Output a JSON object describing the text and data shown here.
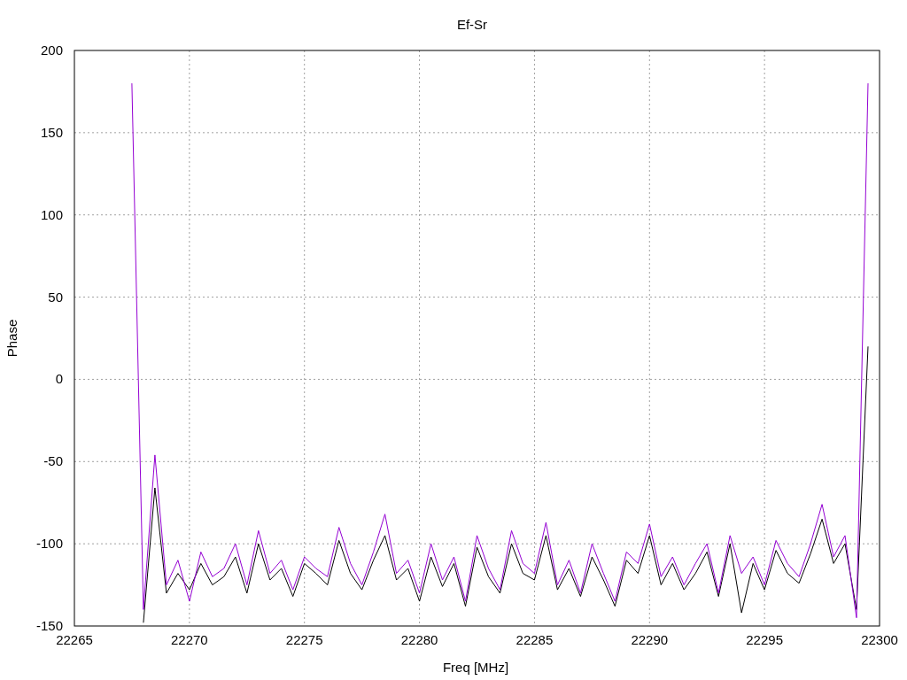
{
  "chart_data": {
    "type": "line",
    "grid": true,
    "title": "Ef-Sr",
    "xlabel": "Freq [MHz]",
    "ylabel": "Phase",
    "xlim": [
      22265,
      22300
    ],
    "ylim": [
      -150,
      200
    ],
    "xticks": [
      22265,
      22270,
      22275,
      22280,
      22285,
      22290,
      22295,
      22300
    ],
    "yticks": [
      -150,
      -100,
      -50,
      0,
      50,
      100,
      150,
      200
    ],
    "x": [
      22267.5,
      22268,
      22268.5,
      22269,
      22269.5,
      22270,
      22270.5,
      22271,
      22271.5,
      22272,
      22272.5,
      22273,
      22273.5,
      22274,
      22274.5,
      22275,
      22275.5,
      22276,
      22276.5,
      22277,
      22277.5,
      22278,
      22278.5,
      22279,
      22279.5,
      22280,
      22280.5,
      22281,
      22281.5,
      22282,
      22282.5,
      22283,
      22283.5,
      22284,
      22284.5,
      22285,
      22285.5,
      22286,
      22286.5,
      22287,
      22287.5,
      22288,
      22288.5,
      22289,
      22289.5,
      22290,
      22290.5,
      22291,
      22291.5,
      22292,
      22292.5,
      22293,
      22293.5,
      22294,
      22294.5,
      22295,
      22295.5,
      22296,
      22296.5,
      22297,
      22297.5,
      22298,
      22298.5,
      22299,
      22299.5
    ],
    "series": [
      {
        "color": "#000000",
        "values": [
          null,
          -148,
          -66,
          -130,
          -118,
          -128,
          -112,
          -125,
          -120,
          -108,
          -130,
          -100,
          -122,
          -115,
          -132,
          -112,
          -118,
          -125,
          -98,
          -118,
          -128,
          -110,
          -95,
          -122,
          -115,
          -135,
          -108,
          -126,
          -112,
          -138,
          -102,
          -120,
          -130,
          -100,
          -118,
          -122,
          -95,
          -128,
          -115,
          -132,
          -108,
          -122,
          -138,
          -110,
          -118,
          -95,
          -125,
          -112,
          -128,
          -118,
          -105,
          -132,
          -100,
          -142,
          -112,
          -128,
          -104,
          -118,
          -124,
          -106,
          -85,
          -112,
          -100,
          -140,
          20
        ]
      },
      {
        "color": "#9400d3",
        "values": [
          180,
          -140,
          -46,
          -125,
          -110,
          -135,
          -105,
          -120,
          -115,
          -100,
          -125,
          -92,
          -118,
          -110,
          -128,
          -108,
          -115,
          -120,
          -90,
          -112,
          -125,
          -105,
          -82,
          -118,
          -110,
          -130,
          -100,
          -122,
          -108,
          -135,
          -95,
          -115,
          -128,
          -92,
          -112,
          -118,
          -87,
          -125,
          -110,
          -130,
          -100,
          -118,
          -135,
          -105,
          -112,
          -88,
          -120,
          -108,
          -125,
          -112,
          -100,
          -130,
          -95,
          -118,
          -108,
          -125,
          -98,
          -112,
          -120,
          -100,
          -76,
          -108,
          -95,
          -145,
          180
        ]
      }
    ]
  }
}
